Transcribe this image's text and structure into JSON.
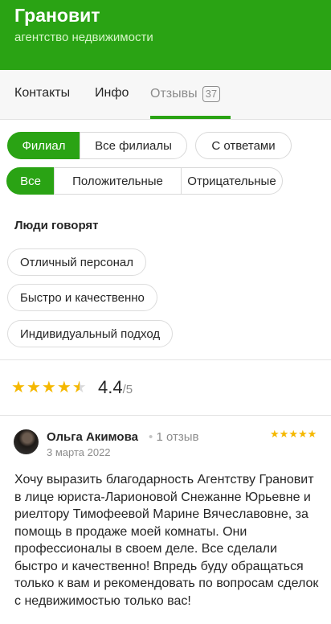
{
  "header": {
    "title": "Грановит",
    "subtitle": "агентство недвижимости",
    "bg_color": "#2aa314"
  },
  "tabs": [
    {
      "label": "Контакты"
    },
    {
      "label": "Инфо"
    },
    {
      "label": "Отзывы",
      "count": "37",
      "active": true
    }
  ],
  "filters": {
    "scope": [
      "Филиал",
      "Все филиалы",
      "С ответами"
    ],
    "scope_active": "Филиал",
    "sentiment": [
      "Все",
      "Положительные",
      "Отрицательные"
    ],
    "sentiment_active": "Все"
  },
  "people_say": {
    "title": "Люди говорят",
    "tags": [
      "Отличный персонал",
      "Быстро и качественно",
      "Индивидуальный подход"
    ]
  },
  "rating": {
    "value": "4.4",
    "max": "/5",
    "stars_fraction": 0.88
  },
  "review": {
    "author": "Ольга Акимова",
    "reviews_count": "1 отзыв",
    "date": "3 марта 2022",
    "stars": 5,
    "text": "Хочу выразить благодарность Агентству Грановит в лице юриста-Ларионовой Снежанне Юрьевне и риелтору Тимофеевой Марине Вячеславовне, за помощь в продаже моей комнаты. Они профессионалы в своем деле. Все сделали быстро и качественно! Впредь буду обращаться только к вам и рекомендовать по вопросам сделок с недвижимостью только вас!"
  },
  "colors": {
    "accent": "#2aa314",
    "star": "#f5b800"
  }
}
